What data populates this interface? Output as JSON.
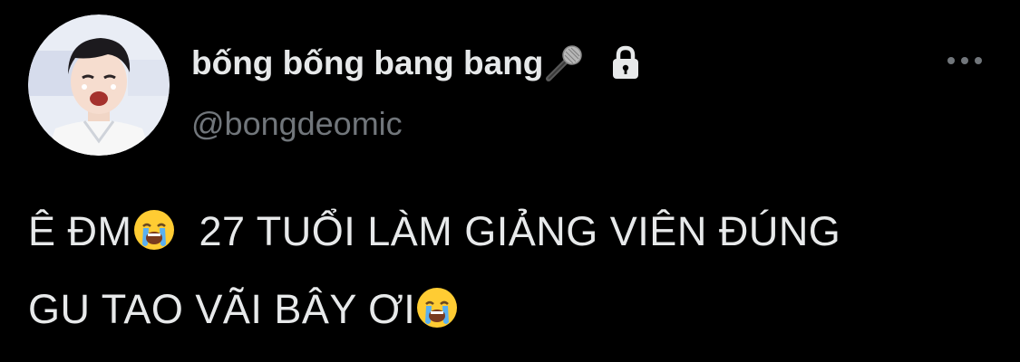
{
  "tweet": {
    "display_name": "bống bống bang bang",
    "handle": "@bongdeomic",
    "text_line_1_a": "Ê ĐM",
    "text_line_1_b": "27 TUỔI LÀM GIẢNG VIÊN ĐÚNG",
    "text_line_2": "GU TAO VÃI BÂY ƠI",
    "name_icon": "microphone-emoji",
    "protected_icon": "lock-icon",
    "more_icon": "more-horizontal-icon",
    "text_emoji": "loudly-crying-face-emoji"
  },
  "colors": {
    "background": "#000000",
    "primary_text": "#e7e9ea",
    "secondary_text": "#71767b"
  }
}
